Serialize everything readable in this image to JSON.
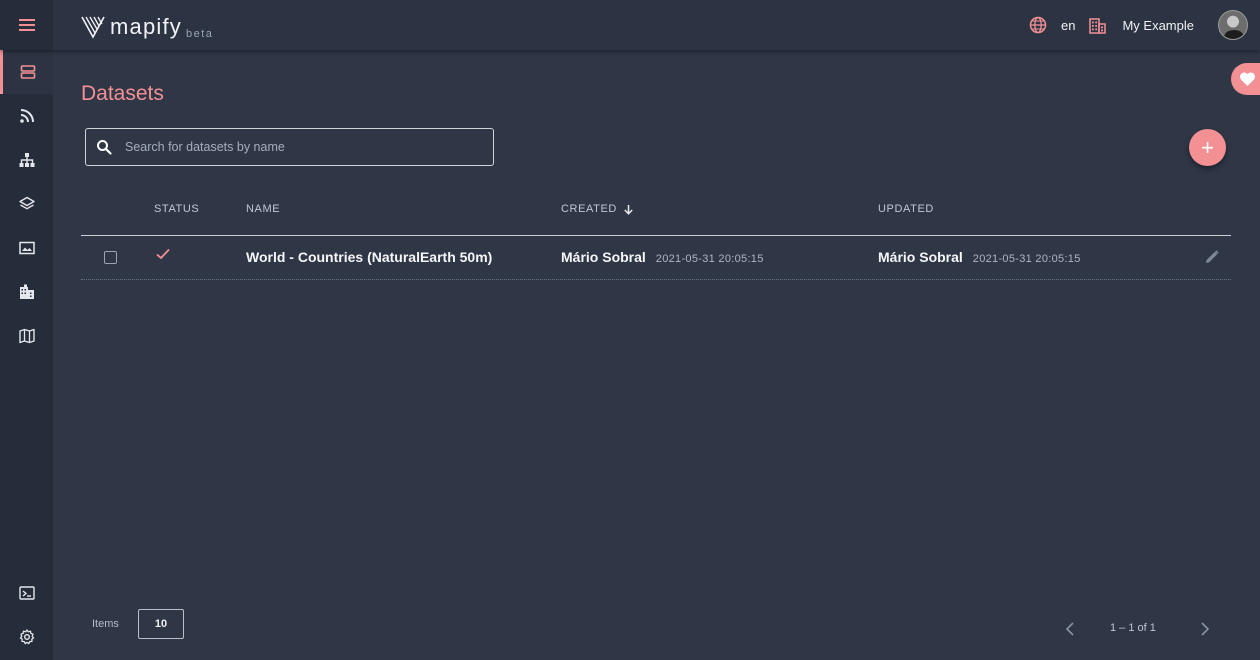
{
  "app": {
    "logo_text": "mapify",
    "logo_badge": "beta",
    "language": "en",
    "organization": "My Example"
  },
  "sidebar": {
    "items": [
      {
        "icon": "datasets-icon",
        "active": true
      },
      {
        "icon": "rss-feed-icon"
      },
      {
        "icon": "sitemap-icon"
      },
      {
        "icon": "layers-icon"
      },
      {
        "icon": "image-icon"
      },
      {
        "icon": "building-icon"
      },
      {
        "icon": "map-icon"
      }
    ],
    "bottom_items": [
      {
        "icon": "terminal-icon"
      },
      {
        "icon": "settings-icon"
      }
    ]
  },
  "page": {
    "title": "Datasets",
    "search_placeholder": "Search for datasets by name"
  },
  "table": {
    "columns": {
      "status": "STATUS",
      "name": "NAME",
      "created": "CREATED",
      "updated": "UPDATED"
    },
    "sort": {
      "column": "created",
      "direction": "desc"
    },
    "rows": [
      {
        "status": "ok",
        "name": "World - Countries (NaturalEarth 50m)",
        "created_by": "Mário Sobral",
        "created_at": "2021-05-31 20:05:15",
        "updated_by": "Mário Sobral",
        "updated_at": "2021-05-31 20:05:15"
      }
    ]
  },
  "footer": {
    "items_label": "Items",
    "items_per_page": "10",
    "range_text": "1 – 1 of 1"
  },
  "colors": {
    "accent": "#f39094",
    "background": "#2f3747",
    "sidebar": "#262d3a"
  }
}
